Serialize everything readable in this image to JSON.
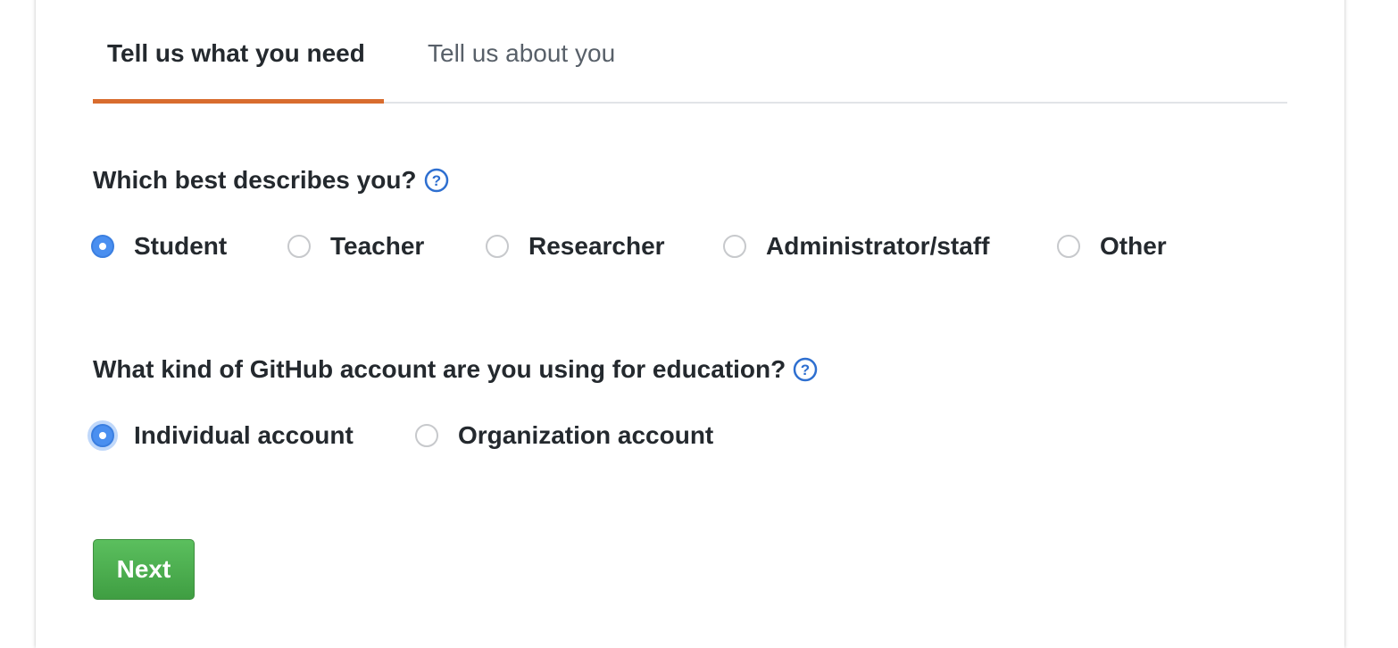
{
  "tabs": [
    {
      "label": "Tell us what you need",
      "active": true
    },
    {
      "label": "Tell us about you",
      "active": false
    }
  ],
  "accent_color": "#d86c2e",
  "question1": {
    "text": "Which best describes you?",
    "help_icon": "question-circle-icon",
    "options": [
      "Student",
      "Teacher",
      "Researcher",
      "Administrator/staff",
      "Other"
    ],
    "selected": "Student"
  },
  "question2": {
    "text": "What kind of GitHub account are you using for education?",
    "help_icon": "question-circle-icon",
    "options": [
      "Individual account",
      "Organization account"
    ],
    "selected": "Individual account"
  },
  "next_button": {
    "label": "Next",
    "color": "#4cae4f"
  }
}
